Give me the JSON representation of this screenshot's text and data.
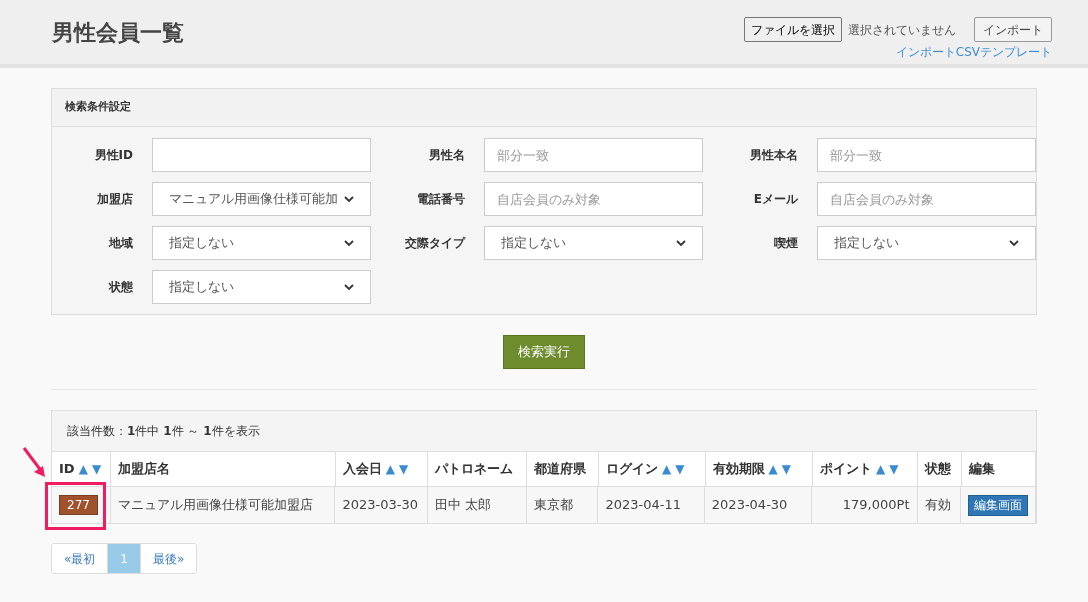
{
  "page_title": "男性会員一覧",
  "import": {
    "file_button": "ファイルを選択",
    "file_status": "選択されていません",
    "import_button": "インポート",
    "template_link": "インポートCSVテンプレート"
  },
  "search_panel": {
    "title": "検索条件設定",
    "fields": [
      {
        "label": "男性ID",
        "kind": "text"
      },
      {
        "label": "男性名",
        "kind": "text",
        "placeholder": "部分一致"
      },
      {
        "label": "男性本名",
        "kind": "text",
        "placeholder": "部分一致"
      },
      {
        "label": "加盟店",
        "kind": "select",
        "value": "マニュアル用画像仕様可能加"
      },
      {
        "label": "電話番号",
        "kind": "text",
        "placeholder": "自店会員のみ対象"
      },
      {
        "label": "Eメール",
        "kind": "text",
        "placeholder": "自店会員のみ対象"
      },
      {
        "label": "地域",
        "kind": "select",
        "value": "指定しない"
      },
      {
        "label": "交際タイプ",
        "kind": "select",
        "value": "指定しない"
      },
      {
        "label": "喫煙",
        "kind": "select",
        "value": "指定しない"
      },
      {
        "label": "状態",
        "kind": "select",
        "value": "指定しない"
      }
    ],
    "submit": "検索実行"
  },
  "results": {
    "summary": "該当件数：**1**件中 **1**件 ～ **1**件を表示",
    "columns": [
      {
        "label": "ID",
        "sort_up": "▲",
        "sort_down": "▼"
      },
      {
        "label": "加盟店名"
      },
      {
        "label": "入会日",
        "sort_up": "▲",
        "sort_down": "▼"
      },
      {
        "label": "パトロネーム"
      },
      {
        "label": "都道府県"
      },
      {
        "label": "ログイン",
        "sort_up": "▲",
        "sort_down": "▼"
      },
      {
        "label": "有効期限",
        "sort_up": "▲",
        "sort_down": "▼"
      },
      {
        "label": "ポイント",
        "sort_up": "▲",
        "sort_down": "▼"
      },
      {
        "label": "状態"
      },
      {
        "label": "編集"
      }
    ],
    "rows": [
      {
        "id": "277",
        "store": "マニュアル用画像仕様可能加盟店",
        "joined": "2023-03-30",
        "name": "田中 太郎",
        "prefecture": "東京都",
        "login": "2023-04-11",
        "expires": "2023-04-30",
        "points": "179,000Pt",
        "status": "有効",
        "edit": "編集画面",
        "highlighted": true
      }
    ]
  },
  "pagination": [
    {
      "label": "«最初",
      "selected": false
    },
    {
      "label": "1",
      "selected": true
    },
    {
      "label": "最後»",
      "selected": false
    }
  ]
}
